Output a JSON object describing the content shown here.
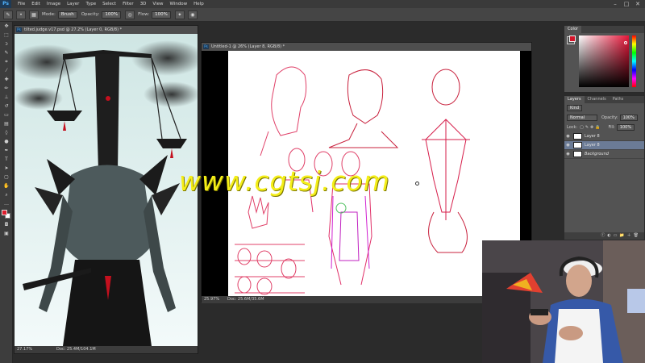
{
  "menubar": {
    "logo": "Ps",
    "items": [
      "File",
      "Edit",
      "Image",
      "Layer",
      "Type",
      "Select",
      "Filter",
      "3D",
      "View",
      "Window",
      "Help"
    ],
    "minimize": "–",
    "maximize": "□",
    "close": "✕"
  },
  "options": {
    "mode_label": "Mode:",
    "mode_value": "Brush",
    "opacity_label": "Opacity:",
    "opacity_value": "100%",
    "flow_label": "Flow:",
    "flow_value": "100%"
  },
  "doc_left": {
    "title": "tilted.judge.v17.psd @ 27.2% (Layer 0, RGB/8) *",
    "zoom": "27.17%",
    "info": "Doc: 25.4M/104.1M"
  },
  "doc_right": {
    "title": "Untitled-1 @ 26% (Layer 8, RGB/8) *",
    "zoom": "25.97%",
    "info": "Doc: 25.6M/35.6M"
  },
  "color_panel": {
    "tab": "Color",
    "fg": "#d4142a",
    "bg": "#ffffff"
  },
  "layers_panel": {
    "tabs": [
      "Layers",
      "Channels",
      "Paths"
    ],
    "filter": "Kind",
    "blend_mode": "Normal",
    "opacity_label": "Opacity:",
    "opacity_value": "100%",
    "lock_label": "Lock:",
    "fill_label": "Fill:",
    "fill_value": "100%",
    "layers": [
      {
        "name": "Layer 8",
        "selected": false
      },
      {
        "name": "Layer 8",
        "selected": true
      },
      {
        "name": "Background",
        "selected": false
      }
    ]
  },
  "watermark": "www.cgtsj.com",
  "colors": {
    "accent": "#d4142a",
    "watermark": "#f4ee18"
  }
}
